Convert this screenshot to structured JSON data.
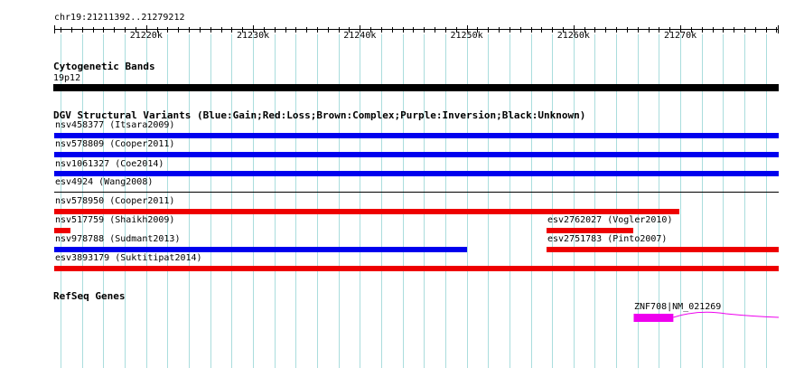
{
  "ruler": {
    "location": "chr19:21211392..21279212",
    "start": 21211392,
    "end": 21279212,
    "ticks": [
      {
        "pos": 21220000,
        "label": "21220k"
      },
      {
        "pos": 21230000,
        "label": "21230k"
      },
      {
        "pos": 21240000,
        "label": "21240k"
      },
      {
        "pos": 21250000,
        "label": "21250k"
      },
      {
        "pos": 21260000,
        "label": "21260k"
      },
      {
        "pos": 21270000,
        "label": "21270k"
      }
    ]
  },
  "colors": {
    "gain": "#0000ee",
    "loss": "#ee0000",
    "band": "#000000",
    "gene": "#ee00ee",
    "grid": "#aadddd"
  },
  "cyto": {
    "title": "Cytogenetic Bands",
    "band_label": "19p12"
  },
  "dgv": {
    "title": "DGV Structural Variants (Blue:Gain;Red:Loss;Brown:Complex;Purple:Inversion;Black:Unknown)",
    "variants": [
      {
        "label": "nsv458377 (Itsara2009)",
        "type": "gain",
        "start": 21211392,
        "end": 21279212
      },
      {
        "label": "nsv578809 (Cooper2011)",
        "type": "gain",
        "start": 21211392,
        "end": 21279212
      },
      {
        "label": "nsv1061327 (Coe2014)",
        "type": "gain",
        "start": 21211392,
        "end": 21279212
      },
      {
        "label": "esv4924 (Wang2008)",
        "type": "gain",
        "start": 21211392,
        "end": 21279212
      },
      {
        "label": "nsv578950 (Cooper2011)",
        "type": "loss",
        "start": 21211392,
        "end": 21269950
      },
      {
        "label": "nsv517759 (Shaikh2009)",
        "type": "loss",
        "start": 21211392,
        "end": 21212900
      },
      {
        "label": "esv2762027 (Vogler2010)",
        "type": "loss",
        "start": 21257450,
        "end": 21265560
      },
      {
        "label": "nsv978788 (Sudmant2013)",
        "type": "gain",
        "start": 21211392,
        "end": 21250020
      },
      {
        "label": "esv2751783 (Pinto2007)",
        "type": "loss",
        "start": 21257450,
        "end": 21279212
      },
      {
        "label": "esv3893179 (Suktitipat2014)",
        "type": "loss",
        "start": 21211392,
        "end": 21279212
      }
    ]
  },
  "refseq": {
    "title": "RefSeq Genes",
    "gene_label": "ZNF708|NM_021269",
    "exon_start": 21265640,
    "exon_end": 21269350,
    "intron_end": 21279212
  }
}
